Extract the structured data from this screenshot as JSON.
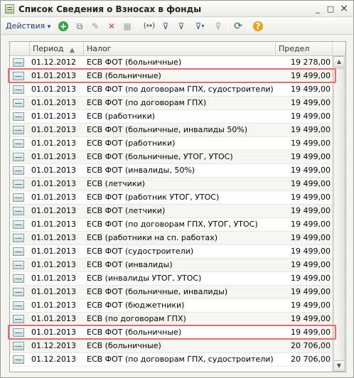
{
  "window": {
    "title": "Список Сведения о Взносах в фонды",
    "minimize_label": "_",
    "maximize_label": "□",
    "close_label": "×"
  },
  "toolbar": {
    "actions_label": "Действия",
    "actions_arrow": "▾",
    "add_glyph": "+",
    "copy_glyph": "⧉",
    "edit_glyph": "✎",
    "delete_glyph": "✕",
    "save_glyph": "▦",
    "range_glyph": "(↔)",
    "filter_glyph": "⊽",
    "filter_arrow": "▾",
    "filter_off_glyph": "⊽",
    "refresh_glyph": "⟳",
    "help_glyph": "?",
    "colors": {
      "add": "#3aa34a",
      "delete": "#d93a2b",
      "help": "#e8a317"
    }
  },
  "table": {
    "columns": [
      "Период",
      "Налог",
      "Предел"
    ],
    "sort_indicator": "▲",
    "rows": [
      {
        "period": "01.12.2012",
        "tax": "ЕСВ ФОТ (больничные)",
        "limit": "19 278,00"
      },
      {
        "period": "01.01.2013",
        "tax": "ЕСВ (больничные)",
        "limit": "19 499,00"
      },
      {
        "period": "01.01.2013",
        "tax": "ЕСВ ФОТ (по договорам ГПХ, судостроители)",
        "limit": "19 499,00"
      },
      {
        "period": "01.01.2013",
        "tax": "ЕСВ ФОТ (по договорам ГПХ)",
        "limit": "19 499,00"
      },
      {
        "period": "01.01.2013",
        "tax": "ЕСВ (работники)",
        "limit": "19 499,00"
      },
      {
        "period": "01.01.2013",
        "tax": "ЕСВ ФОТ (больничные, инвалиды 50%)",
        "limit": "19 499,00"
      },
      {
        "period": "01.01.2013",
        "tax": "ЕСВ ФОТ (работники)",
        "limit": "19 499,00"
      },
      {
        "period": "01.01.2013",
        "tax": "ЕСВ ФОТ (больничные, УТОГ, УТОС)",
        "limit": "19 499,00"
      },
      {
        "period": "01.01.2013",
        "tax": "ЕСВ ФОТ (инвалиды, 50%)",
        "limit": "19 499,00"
      },
      {
        "period": "01.01.2013",
        "tax": "ЕСВ (летчики)",
        "limit": "19 499,00"
      },
      {
        "period": "01.01.2013",
        "tax": "ЕСВ ФОТ (работник УТОГ, УТОС)",
        "limit": "19 499,00"
      },
      {
        "period": "01.01.2013",
        "tax": "ЕСВ ФОТ (летчики)",
        "limit": "19 499,00"
      },
      {
        "period": "01.01.2013",
        "tax": "ЕСВ ФОТ (по договорам ГПХ, УТОГ, УТОС)",
        "limit": "19 499,00"
      },
      {
        "period": "01.01.2013",
        "tax": "ЕСВ (работники на сп. работах)",
        "limit": "19 499,00"
      },
      {
        "period": "01.01.2013",
        "tax": "ЕСВ ФОТ (судостроители)",
        "limit": "19 499,00"
      },
      {
        "period": "01.01.2013",
        "tax": "ЕСВ ФОТ (инвалиды)",
        "limit": "19 499,00"
      },
      {
        "period": "01.01.2013",
        "tax": "ЕСВ (инвалиды УТОГ, УТОС)",
        "limit": "19 499,00"
      },
      {
        "period": "01.01.2013",
        "tax": "ЕСВ ФОТ (больничные, инвалиды)",
        "limit": "19 499,00"
      },
      {
        "period": "01.01.2013",
        "tax": "ЕСВ ФОТ (бюджетники)",
        "limit": "19 499,00"
      },
      {
        "period": "01.01.2013",
        "tax": "ЕСВ (по договорам ГПХ)",
        "limit": "19 499,00"
      },
      {
        "period": "01.01.2013",
        "tax": "ЕСВ ФОТ (больничные)",
        "limit": "19 499,00"
      },
      {
        "period": "01.12.2013",
        "tax": "ЕСВ (больничные)",
        "limit": "20 706,00"
      },
      {
        "period": "01.12.2013",
        "tax": "ЕСВ ФОТ (по договорам ГПХ, судостроители)",
        "limit": "20 706,00"
      }
    ],
    "highlighted_rows": [
      1,
      20
    ],
    "highlight_color": "#e86a6f"
  },
  "scrollbar": {
    "up_arrow": "▲",
    "down_arrow": "▼"
  }
}
